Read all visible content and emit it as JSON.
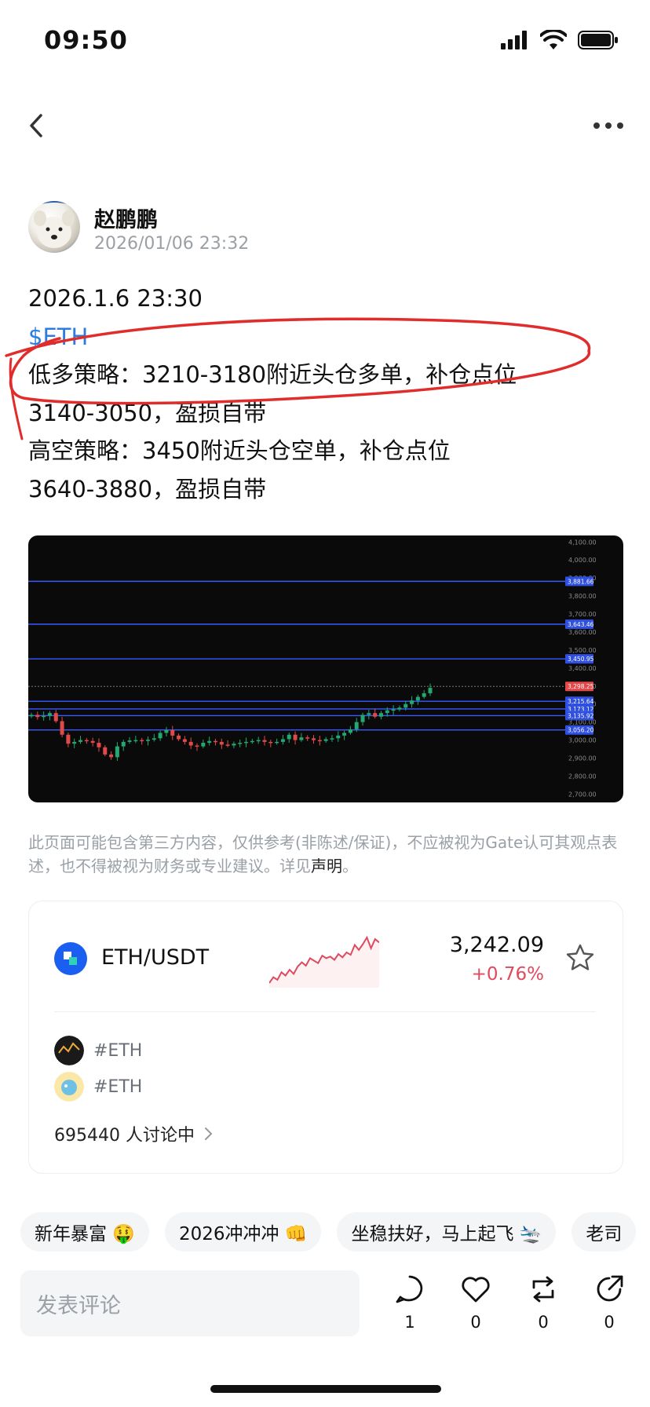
{
  "status_bar": {
    "time": "09:50"
  },
  "author": {
    "name": "赵鹏鹏",
    "date": "2026/01/06 23:32"
  },
  "post": {
    "lines": [
      "2026.1.6 23:30",
      "$ETH",
      "低多策略：3210-3180附近头仓多单，补仓点位",
      "3140-3050，盈损自带",
      "高空策略：3450附近头仓空单，补仓点位",
      "3640-3880，盈损自带"
    ]
  },
  "chart_data": {
    "type": "candlestick",
    "title": "",
    "y_ticks": [
      "4,100.00",
      "4,000.00",
      "3,900.00",
      "3,800.00",
      "3,700.00",
      "3,600.00",
      "3,500.00",
      "3,400.00",
      "3,300.00",
      "3,200.00",
      "3,100.00",
      "3,000.00",
      "2,900.00",
      "2,800.00",
      "2,700.00"
    ],
    "ylim": [
      2680,
      4110
    ],
    "level_lines": [
      {
        "value": 3881.66,
        "label": "3,881.66"
      },
      {
        "value": 3643.46,
        "label": "3,643.46"
      },
      {
        "value": 3450.95,
        "label": "3,450.95"
      },
      {
        "value": 3215.64,
        "label": "3,215.64"
      },
      {
        "value": 3173.12,
        "label": "3,173.12"
      },
      {
        "value": 3135.92,
        "label": "3,135.92"
      },
      {
        "value": 3056.2,
        "label": "3,056.20"
      }
    ],
    "last_price": {
      "value": 3298.25,
      "label": "3,298.25"
    },
    "close_series": [
      3140,
      3128,
      3135,
      3150,
      3105,
      3030,
      2980,
      2990,
      3000,
      2995,
      2985,
      2960,
      2920,
      2905,
      2965,
      2990,
      2998,
      3000,
      2995,
      3002,
      3010,
      3040,
      3055,
      3025,
      3005,
      2990,
      2970,
      2965,
      2985,
      2995,
      2990,
      2975,
      2970,
      2980,
      2985,
      2990,
      2995,
      3000,
      2990,
      2985,
      2990,
      3005,
      3030,
      3000,
      3015,
      3010,
      3000,
      2995,
      3005,
      3010,
      3025,
      3040,
      3060,
      3100,
      3140,
      3150,
      3130,
      3150,
      3165,
      3170,
      3180,
      3200,
      3220,
      3240,
      3260,
      3290
    ]
  },
  "disclaimer": {
    "text": "此页面可能包含第三方内容，仅供参考(非陈述/保证)，不应被视为Gate认可其观点表述，也不得被视为财务或专业建议。详见",
    "link": "声明",
    "end": "。"
  },
  "market": {
    "pair": "ETH/USDT",
    "price": "3,242.09",
    "change": "+0.76%",
    "accent": "#e04a5e",
    "sparkline": [
      3165,
      3172,
      3169,
      3178,
      3174,
      3181,
      3176,
      3185,
      3190,
      3186,
      3195,
      3192,
      3189,
      3198,
      3195,
      3197,
      3193,
      3200,
      3196,
      3202,
      3199,
      3211,
      3205,
      3212,
      3220,
      3207,
      3218,
      3214
    ]
  },
  "topics": [
    "#ETH",
    "#ETH"
  ],
  "discussion": {
    "count_text": "695440 人讨论中"
  },
  "quick_tags": [
    "新年暴富 🤑",
    "2026冲冲冲 👊",
    "坐稳扶好，马上起飞 🛬",
    "老司"
  ],
  "comment": {
    "placeholder": "发表评论"
  },
  "actions": {
    "comments": "1",
    "likes": "0",
    "reposts": "0",
    "shares": "0"
  }
}
